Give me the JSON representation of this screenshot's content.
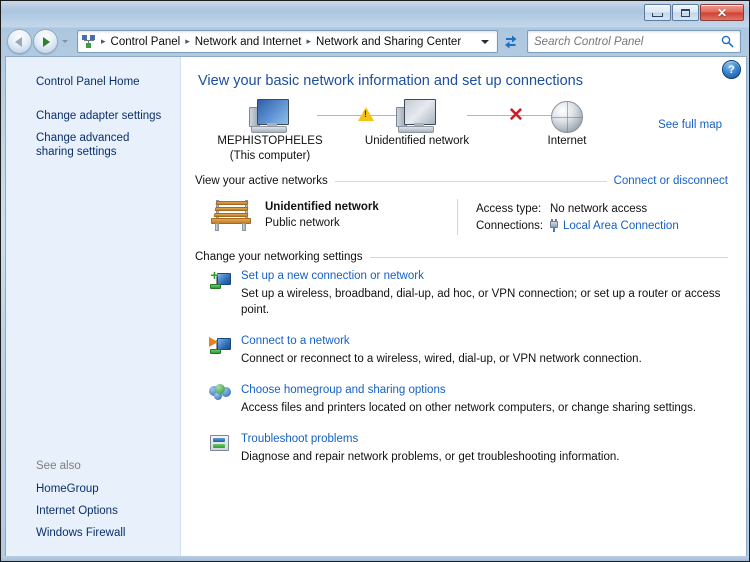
{
  "window": {
    "caption_buttons": {
      "minimize_label": "Minimize",
      "maximize_label": "Maximize",
      "close_label": "✕"
    }
  },
  "navbar": {
    "back_label": "Back",
    "forward_label": "Forward",
    "recent_pages_label": "Recent pages",
    "address_icon": "control-panel-icon",
    "breadcrumbs": [
      "Control Panel",
      "Network and Internet",
      "Network and Sharing Center"
    ],
    "separator": "▸",
    "refresh_label": "Refresh",
    "search": {
      "value": "",
      "placeholder": "Search Control Panel"
    }
  },
  "sidebar": {
    "items": [
      {
        "label": "Control Panel Home"
      },
      {
        "label": "Change adapter settings"
      },
      {
        "label": "Change advanced sharing settings"
      }
    ],
    "see_also_title": "See also",
    "see_also_items": [
      {
        "label": "HomeGroup"
      },
      {
        "label": "Internet Options"
      },
      {
        "label": "Windows Firewall"
      }
    ]
  },
  "content": {
    "help_label": "?",
    "page_title": "View your basic network information and set up connections",
    "network_map": {
      "see_full_map": "See full map",
      "nodes": [
        {
          "icon": "this-computer-icon",
          "label_line1": "MEPHISTOPHELES",
          "label_line2": "(This computer)"
        },
        {
          "icon": "unidentified-network-icon",
          "label_line1": "Unidentified network",
          "label_line2": ""
        },
        {
          "icon": "internet-globe-icon",
          "label_line1": "Internet",
          "label_line2": ""
        }
      ],
      "link_badges": [
        {
          "type": "warning",
          "glyph": "!"
        },
        {
          "type": "error",
          "glyph": "✕"
        }
      ]
    },
    "active_networks": {
      "header": "View your active networks",
      "action_link": "Connect or disconnect",
      "network": {
        "icon": "park-bench-icon",
        "name": "Unidentified network",
        "type": "Public network",
        "details": [
          {
            "key": "Access type:",
            "value": "No network access",
            "is_link": false
          },
          {
            "key": "Connections:",
            "value": "Local Area Connection",
            "is_link": true,
            "icon": "ethernet-plug-icon"
          }
        ]
      }
    },
    "settings": {
      "header": "Change your networking settings",
      "items": [
        {
          "icon": "new-connection-icon",
          "link": "Set up a new connection or network",
          "description": "Set up a wireless, broadband, dial-up, ad hoc, or VPN connection; or set up a router or access point."
        },
        {
          "icon": "connect-to-network-icon",
          "link": "Connect to a network",
          "description": "Connect or reconnect to a wireless, wired, dial-up, or VPN network connection."
        },
        {
          "icon": "homegroup-icon",
          "link": "Choose homegroup and sharing options",
          "description": "Access files and printers located on other network computers, or change sharing settings."
        },
        {
          "icon": "troubleshoot-icon",
          "link": "Troubleshoot problems",
          "description": "Diagnose and repair network problems, or get troubleshooting information."
        }
      ]
    }
  },
  "colors": {
    "link": "#1661c4",
    "sidebar_link": "#0b2f6b",
    "title": "#1c4f9c",
    "sidebar_bg": "#e7f0fb",
    "warning": "#f3c416",
    "error": "#cc2026"
  }
}
